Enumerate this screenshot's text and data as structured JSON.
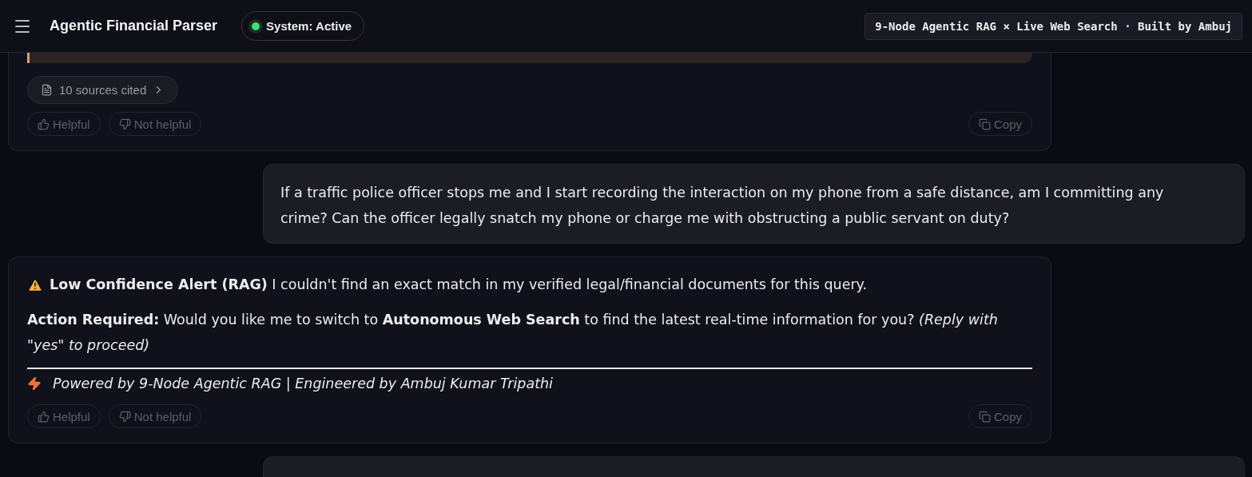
{
  "header": {
    "title": "Agentic Financial Parser",
    "status": {
      "label": "System: Active",
      "on": true
    },
    "banner": "9-Node Agentic RAG × Live Web Search · Built by Ambuj"
  },
  "messages": [
    {
      "kind": "assistant",
      "quote": true,
      "sources": "10 sources cited",
      "feedback": [
        "Helpful",
        "Not helpful"
      ],
      "copy": "Copy"
    },
    {
      "kind": "user",
      "text": "If a traffic police officer stops me and I start recording the interaction on my phone from a safe distance, am I committing any crime? Can the officer legally snatch my phone or charge me with obstructing a public servant on duty?"
    },
    {
      "kind": "assistant",
      "paragraphs": [
        {
          "kind": "alert",
          "text": "**Low Confidence Alert (RAG)** I couldn't find an exact match in my verified legal/financial documents for this query."
        },
        {
          "kind": "plain",
          "text": "**Action Required:** Would you like me to switch to **Autonomous Web Search** to find the latest real-time information for you? *(Reply with \"yes\" to proceed)*"
        }
      ],
      "footer": "Powered by 9-Node Agentic RAG | Engineered by Ambuj Kumar Tripathi",
      "feedback": [
        "Helpful",
        "Not helpful"
      ],
      "copy": "Copy"
    },
    {
      "kind": "user"
    }
  ]
}
